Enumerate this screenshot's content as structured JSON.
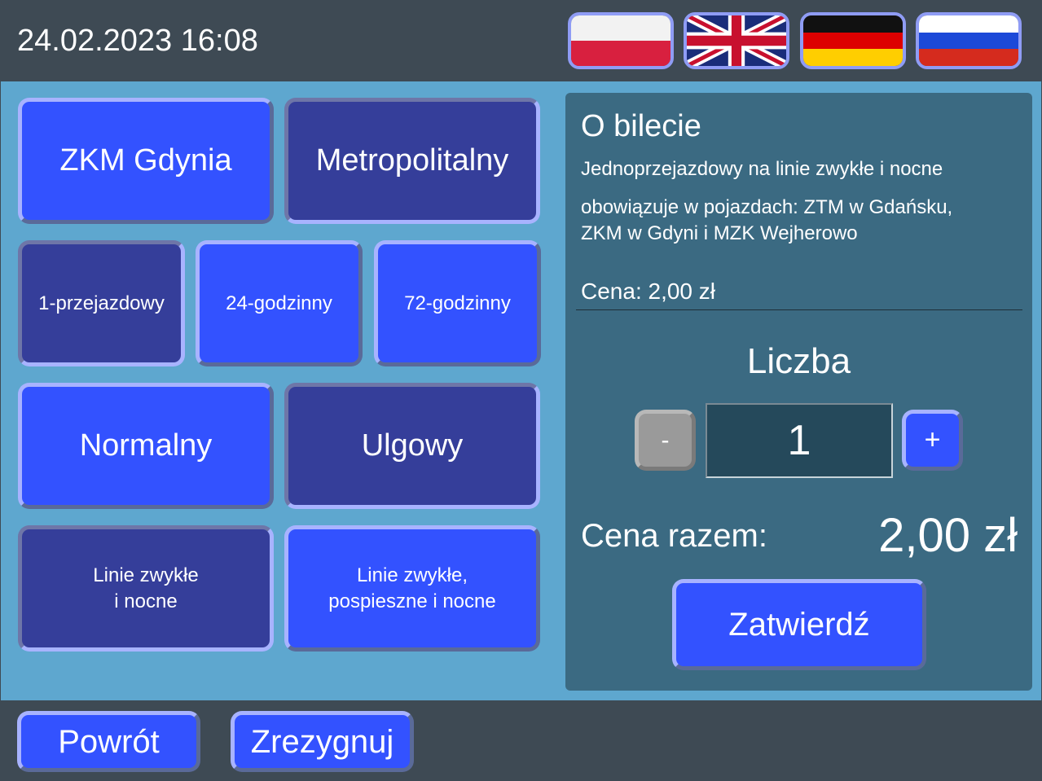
{
  "header": {
    "datetime": "24.02.2023 16:08",
    "languages": [
      {
        "code": "pl",
        "icon": "flag-poland-icon"
      },
      {
        "code": "en",
        "icon": "flag-uk-icon"
      },
      {
        "code": "de",
        "icon": "flag-germany-icon"
      },
      {
        "code": "ru",
        "icon": "flag-russia-icon"
      }
    ]
  },
  "operators": [
    {
      "label": "ZKM Gdynia",
      "selected": true
    },
    {
      "label": "Metropolitalny",
      "selected": false
    }
  ],
  "durations": [
    {
      "label": "1-przejazdowy",
      "selected": false
    },
    {
      "label": "24-godzinny",
      "selected": true
    },
    {
      "label": "72-godzinny",
      "selected": true
    }
  ],
  "fare_types": [
    {
      "label": "Normalny",
      "selected": true
    },
    {
      "label": "Ulgowy",
      "selected": false
    }
  ],
  "line_scopes": [
    {
      "label": "Linie zwykłe\ni nocne",
      "selected": false
    },
    {
      "label": "Linie zwykłe,\npospieszne i nocne",
      "selected": true
    }
  ],
  "ticket_info": {
    "title": "O bilecie",
    "description": "Jednoprzejazdowy na linie zwykłe i nocne",
    "validity": "obowiązuje w pojazdach: ZTM w Gdańsku,\nZKM w Gdyni i MZK Wejherowo",
    "price": "Cena: 2,00 zł",
    "quantity_label": "Liczba",
    "minus_label": "-",
    "quantity": "1",
    "plus_label": "+",
    "total_label": "Cena razem:",
    "total_value": "2,00 zł",
    "confirm_label": "Zatwierdź"
  },
  "footer": {
    "back_label": "Powrót",
    "cancel_label": "Zrezygnuj"
  },
  "colors": {
    "topbar": "#3e4a54",
    "background": "#5ea7cf",
    "panel": "#3b6a82",
    "button_selected": "#3352ff",
    "button_unselected": "#353e9a",
    "button_disabled": "#9a9a9a"
  }
}
